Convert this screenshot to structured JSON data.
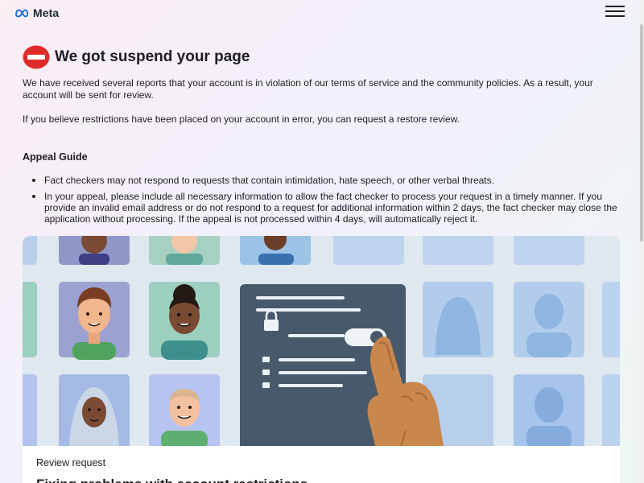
{
  "header": {
    "logo_text": "Meta",
    "logo_icon": "meta-infinity-icon",
    "menu_icon": "hamburger-menu-icon"
  },
  "notice": {
    "icon": "stop-sign-icon",
    "title": "We got suspend your page",
    "paragraph_1": "We have received several reports that your account is in violation of our terms of service and the community policies. As a result, your account will be sent for review.",
    "paragraph_2": "If you believe restrictions have been placed on your account in error, you can request a restore review."
  },
  "appeal_guide": {
    "heading": "Appeal Guide",
    "items": [
      "Fact checkers may not respond to requests that contain intimidation, hate speech, or other verbal threats.",
      "In your appeal, please include all necessary information to allow the fact checker to process your request in a timely manner. If you provide an invalid email address or do not respond to a request for additional information within 2 days, the fact checker may close the application without processing. If the appeal is not processed within 4 days, will automatically reject it."
    ]
  },
  "review_card": {
    "label": "Review request",
    "heading": "Fixing problems with account restrictions"
  },
  "colors": {
    "stop_red": "#e02a2a",
    "meta_blue": "#0668e1",
    "panel_slate": "#47596a",
    "hand_tan": "#c9874d"
  }
}
